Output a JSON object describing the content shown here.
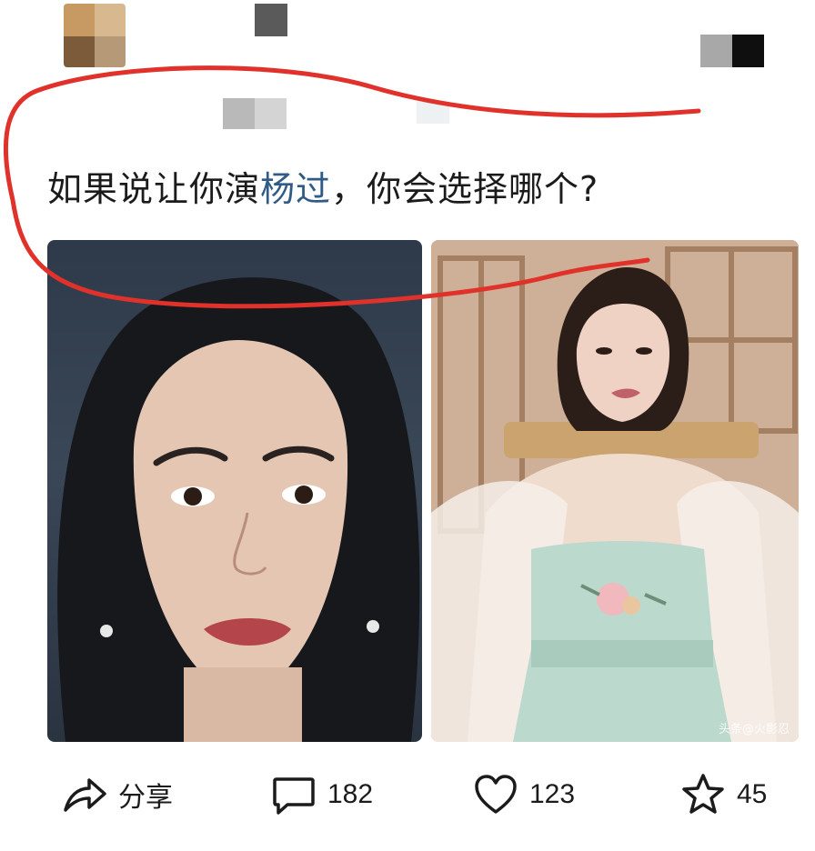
{
  "post": {
    "text_before_link": "如果说让你演",
    "link_text": "杨过",
    "text_after_link": "，你会选择哪个?"
  },
  "images": {
    "right_watermark": "头条@火影忍"
  },
  "actions": {
    "share_label": "分享",
    "comments_count": "182",
    "likes_count": "123",
    "favorites_count": "45"
  },
  "colors": {
    "text": "#1b1b1b",
    "link": "#2f5b86",
    "annotation_red": "#e0312b"
  },
  "icons": {
    "share": "share-arrow-icon",
    "comment": "comment-bubble-icon",
    "like": "heart-icon",
    "favorite": "star-icon"
  }
}
